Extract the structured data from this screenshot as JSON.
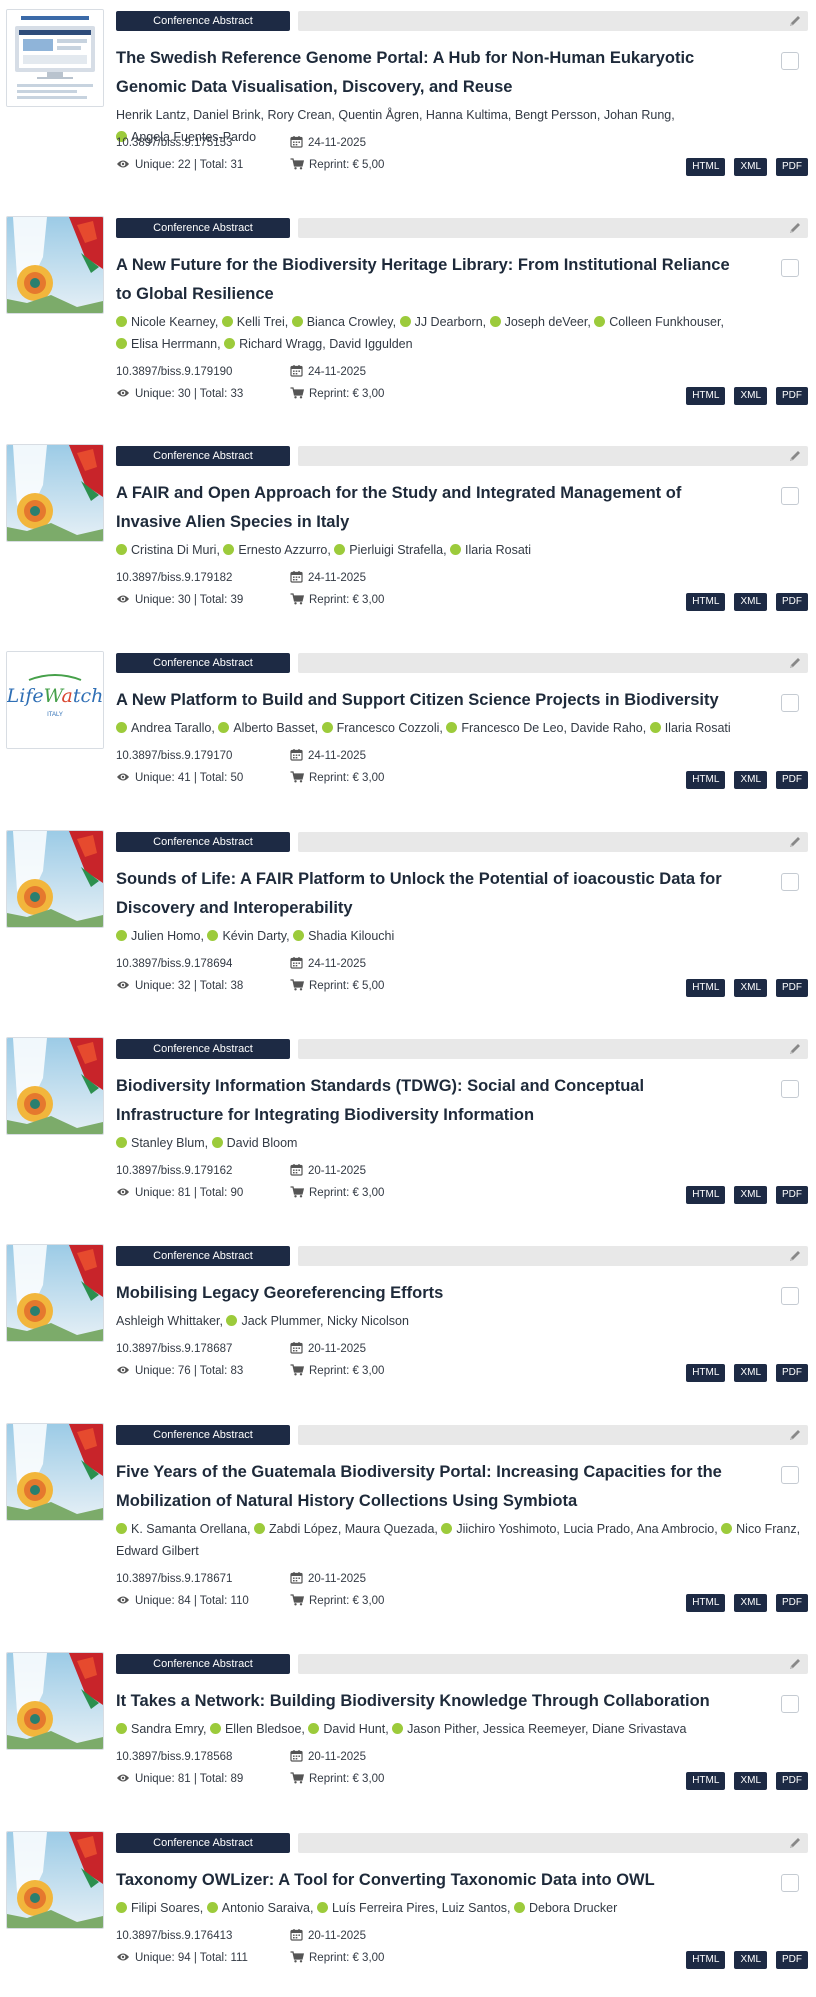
{
  "colors": {
    "badge": "#1d2a44",
    "orcid": "#9ccb3b",
    "bar": "#e8e8e8",
    "text": "#1e2a3a"
  },
  "icons": {
    "edit": "pencil-icon",
    "date": "calendar-icon",
    "views": "eye-icon",
    "reprint": "cart-icon",
    "orcid": "orcid-icon"
  },
  "articles": [
    {
      "type": "Conference Abstract",
      "thumb": "portal",
      "title": "The Swedish Reference Genome Portal: A Hub for Non-Human Eukaryotic Genomic Data Visualisation, Discovery, and Reuse",
      "authors": [
        {
          "name": "Henrik Lantz",
          "orcid": false
        },
        {
          "name": "Daniel Brink",
          "orcid": false
        },
        {
          "name": "Rory Crean",
          "orcid": false
        },
        {
          "name": "Quentin Ågren",
          "orcid": false
        },
        {
          "name": "Hanna Kultima",
          "orcid": false
        },
        {
          "name": "Bengt Persson",
          "orcid": false
        },
        {
          "name": "Johan Rung",
          "orcid": false
        },
        {
          "name": "Angela Fuentes-Pardo",
          "orcid": true
        }
      ],
      "doi": "10.3897/biss.9.175153",
      "date": "24-11-2025",
      "views": "Unique: 22 | Total: 31",
      "reprint": "Reprint: € 5,00",
      "formats": [
        "HTML",
        "XML",
        "PDF"
      ]
    },
    {
      "type": "Conference Abstract",
      "thumb": "living",
      "title": "A New Future for the Biodiversity Heritage Library: From Institutional Reliance to Global Resilience",
      "authors": [
        {
          "name": "Nicole Kearney",
          "orcid": true
        },
        {
          "name": "Kelli Trei",
          "orcid": true
        },
        {
          "name": "Bianca Crowley",
          "orcid": true
        },
        {
          "name": "JJ Dearborn",
          "orcid": true
        },
        {
          "name": "Joseph deVeer",
          "orcid": true
        },
        {
          "name": "Colleen Funkhouser",
          "orcid": true
        },
        {
          "name": "Elisa Herrmann",
          "orcid": true
        },
        {
          "name": "Richard Wragg",
          "orcid": true
        },
        {
          "name": "David Iggulden",
          "orcid": false
        }
      ],
      "doi": "10.3897/biss.9.179190",
      "date": "24-11-2025",
      "views": "Unique: 30 | Total: 33",
      "reprint": "Reprint: € 3,00",
      "formats": [
        "HTML",
        "XML",
        "PDF"
      ]
    },
    {
      "type": "Conference Abstract",
      "thumb": "living",
      "title": "A FAIR and Open Approach for the Study and Integrated Management of Invasive Alien Species in Italy",
      "authors": [
        {
          "name": "Cristina Di Muri",
          "orcid": true
        },
        {
          "name": "Ernesto Azzurro",
          "orcid": true
        },
        {
          "name": "Pierluigi Strafella",
          "orcid": true
        },
        {
          "name": "Ilaria Rosati",
          "orcid": true
        }
      ],
      "doi": "10.3897/biss.9.179182",
      "date": "24-11-2025",
      "views": "Unique: 30 | Total: 39",
      "reprint": "Reprint: € 3,00",
      "formats": [
        "HTML",
        "XML",
        "PDF"
      ]
    },
    {
      "type": "Conference Abstract",
      "thumb": "lifewatch",
      "thumb_text": "LifeWatch",
      "thumb_sub": "ITALY",
      "title": "A New Platform to Build and Support Citizen Science Projects in Biodiversity",
      "authors": [
        {
          "name": "Andrea Tarallo",
          "orcid": true
        },
        {
          "name": "Alberto Basset",
          "orcid": true
        },
        {
          "name": "Francesco Cozzoli",
          "orcid": true
        },
        {
          "name": "Francesco De Leo",
          "orcid": true
        },
        {
          "name": "Davide Raho",
          "orcid": false
        },
        {
          "name": "Ilaria Rosati",
          "orcid": true
        }
      ],
      "doi": "10.3897/biss.9.179170",
      "date": "24-11-2025",
      "views": "Unique: 41 | Total: 50",
      "reprint": "Reprint: € 3,00",
      "formats": [
        "HTML",
        "XML",
        "PDF"
      ]
    },
    {
      "type": "Conference Abstract",
      "thumb": "living",
      "title": "Sounds of Life: A FAIR Platform to Unlock the Potential of ioacoustic Data for Discovery and Interoperability",
      "authors": [
        {
          "name": "Julien Homo",
          "orcid": true
        },
        {
          "name": "Kévin Darty",
          "orcid": true
        },
        {
          "name": "Shadia Kilouchi",
          "orcid": true
        }
      ],
      "doi": "10.3897/biss.9.178694",
      "date": "24-11-2025",
      "views": "Unique: 32 | Total: 38",
      "reprint": "Reprint: € 5,00",
      "formats": [
        "HTML",
        "XML",
        "PDF"
      ]
    },
    {
      "type": "Conference Abstract",
      "thumb": "living",
      "title": "Biodiversity Information Standards (TDWG): Social and Conceptual Infrastructure for Integrating Biodiversity Information",
      "authors": [
        {
          "name": "Stanley Blum",
          "orcid": true
        },
        {
          "name": "David Bloom",
          "orcid": true
        }
      ],
      "doi": "10.3897/biss.9.179162",
      "date": "20-11-2025",
      "views": "Unique: 81 | Total: 90",
      "reprint": "Reprint: € 3,00",
      "formats": [
        "HTML",
        "XML",
        "PDF"
      ]
    },
    {
      "type": "Conference Abstract",
      "thumb": "living",
      "title": "Mobilising Legacy Georeferencing Efforts",
      "authors": [
        {
          "name": "Ashleigh Whittaker",
          "orcid": false
        },
        {
          "name": "Jack Plummer",
          "orcid": true
        },
        {
          "name": "Nicky Nicolson",
          "orcid": false
        }
      ],
      "doi": "10.3897/biss.9.178687",
      "date": "20-11-2025",
      "views": "Unique: 76 | Total: 83",
      "reprint": "Reprint: € 3,00",
      "formats": [
        "HTML",
        "XML",
        "PDF"
      ]
    },
    {
      "type": "Conference Abstract",
      "thumb": "living",
      "title": "Five Years of the Guatemala Biodiversity Portal: Increasing Capacities for the Mobilization of Natural History Collections Using Symbiota",
      "authors": [
        {
          "name": "K. Samanta Orellana",
          "orcid": true
        },
        {
          "name": "Zabdi López",
          "orcid": true
        },
        {
          "name": "Maura Quezada",
          "orcid": false
        },
        {
          "name": "Jiichiro Yoshimoto",
          "orcid": true
        },
        {
          "name": "Lucia Prado",
          "orcid": false
        },
        {
          "name": "Ana Ambrocio",
          "orcid": false
        },
        {
          "name": "Nico Franz",
          "orcid": true
        },
        {
          "name": "Edward Gilbert",
          "orcid": false
        }
      ],
      "doi": "10.3897/biss.9.178671",
      "date": "20-11-2025",
      "views": "Unique: 84 | Total: 110",
      "reprint": "Reprint: € 3,00",
      "formats": [
        "HTML",
        "XML",
        "PDF"
      ]
    },
    {
      "type": "Conference Abstract",
      "thumb": "living",
      "title": "It Takes a Network: Building Biodiversity Knowledge Through Collaboration",
      "authors": [
        {
          "name": "Sandra Emry",
          "orcid": true
        },
        {
          "name": "Ellen Bledsoe",
          "orcid": true
        },
        {
          "name": "David Hunt",
          "orcid": true
        },
        {
          "name": "Jason Pither",
          "orcid": true
        },
        {
          "name": "Jessica Reemeyer",
          "orcid": false
        },
        {
          "name": "Diane Srivastava",
          "orcid": false
        }
      ],
      "doi": "10.3897/biss.9.178568",
      "date": "20-11-2025",
      "views": "Unique: 81 | Total: 89",
      "reprint": "Reprint: € 3,00",
      "formats": [
        "HTML",
        "XML",
        "PDF"
      ]
    },
    {
      "type": "Conference Abstract",
      "thumb": "living",
      "title": "Taxonomy OWLizer: A Tool for Converting Taxonomic Data into OWL",
      "authors": [
        {
          "name": "Filipi Soares",
          "orcid": true
        },
        {
          "name": "Antonio Saraiva",
          "orcid": true
        },
        {
          "name": "Luís Ferreira Pires",
          "orcid": true
        },
        {
          "name": "Luiz Santos",
          "orcid": false
        },
        {
          "name": "Debora Drucker",
          "orcid": true
        }
      ],
      "doi": "10.3897/biss.9.176413",
      "date": "20-11-2025",
      "views": "Unique: 94 | Total: 111",
      "reprint": "Reprint: € 3,00",
      "formats": [
        "HTML",
        "XML",
        "PDF"
      ]
    }
  ]
}
